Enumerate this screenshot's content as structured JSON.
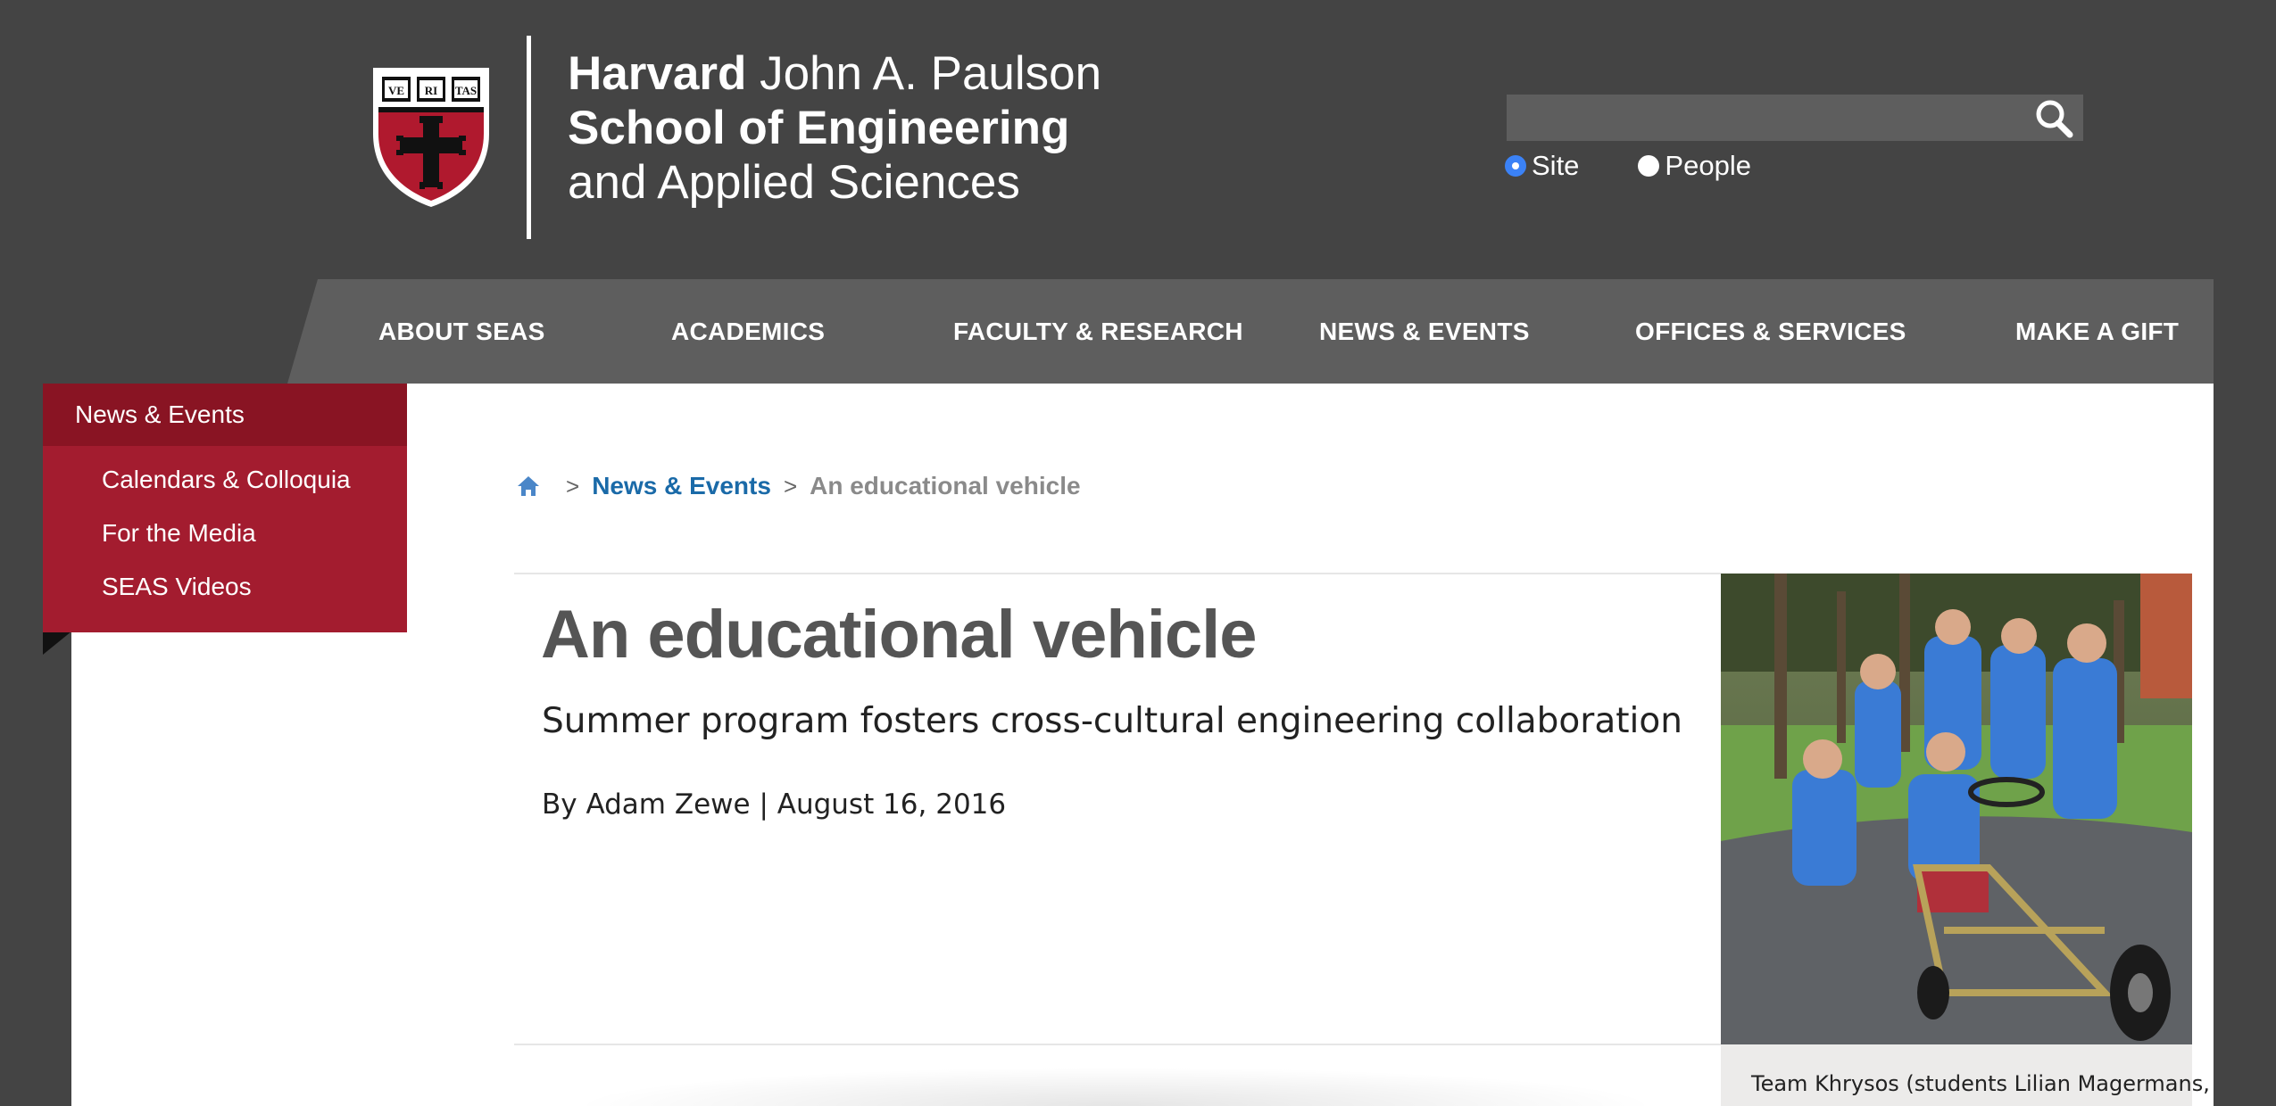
{
  "header": {
    "logo_line1_bold": "Harvard",
    "logo_line1_rest": " John A. Paulson",
    "logo_line2": "School of Engineering",
    "logo_line3": "and Applied Sciences",
    "shield_text": [
      "VE",
      "RI",
      "TAS"
    ],
    "search": {
      "value": "",
      "placeholder": ""
    },
    "search_scope": {
      "options": [
        "Site",
        "People"
      ],
      "selected": "Site"
    }
  },
  "nav": {
    "items": [
      "ABOUT SEAS",
      "ACADEMICS",
      "FACULTY & RESEARCH",
      "NEWS & EVENTS",
      "OFFICES & SERVICES",
      "MAKE A GIFT"
    ]
  },
  "sidenav": {
    "heading": "News & Events",
    "items": [
      "Calendars & Colloquia",
      "For the Media",
      "SEAS Videos"
    ]
  },
  "breadcrumb": {
    "separator": ">",
    "link": "News & Events",
    "current": "An educational vehicle"
  },
  "article": {
    "title": "An educational vehicle",
    "subtitle": "Summer program fosters cross-cultural engineering collaboration",
    "byline": "By Adam Zewe | August 16, 2016",
    "caption": "Team Khrysos (students Lilian Magermans,"
  },
  "colors": {
    "background": "#444444",
    "nav_bar": "#5e5e5e",
    "crimson": "#a31c2f",
    "crimson_dark": "#891423",
    "link_blue": "#1a6aa8"
  },
  "icons": [
    "harvard-seas-shield-icon",
    "search-icon",
    "home-icon",
    "chevron-right-icon"
  ]
}
